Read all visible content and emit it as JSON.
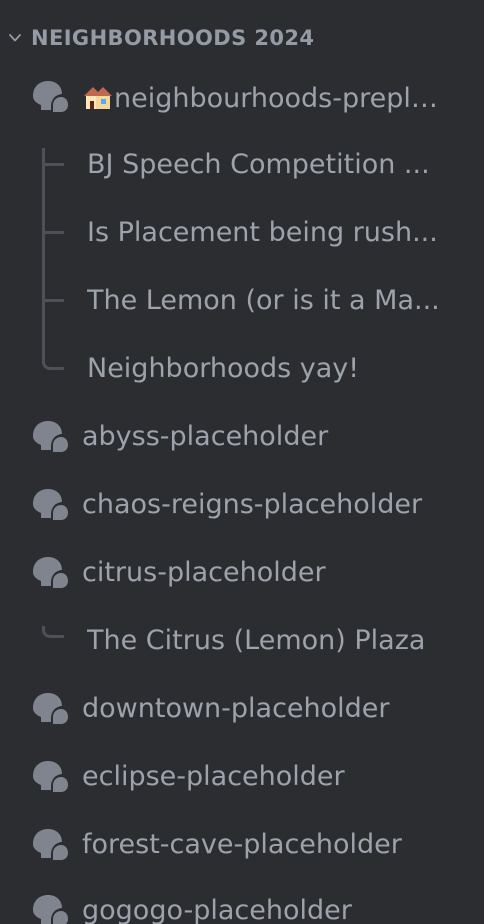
{
  "category": {
    "label": "NEIGHBORHOODS 2024"
  },
  "channels": [
    {
      "label": "neighbourhoods-preplacement",
      "emoji": "house-emoji"
    },
    {
      "label": "abyss-placeholder"
    },
    {
      "label": "chaos-reigns-placeholder"
    },
    {
      "label": "citrus-placeholder"
    },
    {
      "label": "downtown-placeholder"
    },
    {
      "label": "eclipse-placeholder"
    },
    {
      "label": "forest-cave-placeholder"
    },
    {
      "label": "gogogo-placeholder"
    }
  ],
  "threads": {
    "neighbourhoods": [
      {
        "label": "BJ Speech Competition ..."
      },
      {
        "label": "Is Placement being rush..."
      },
      {
        "label": "The Lemon (or is it a Ma..."
      },
      {
        "label": "Neighborhoods yay!"
      }
    ],
    "citrus": [
      {
        "label": "The Citrus (Lemon) Plaza"
      }
    ]
  },
  "colors": {
    "background": "#2b2d31",
    "text": "#9ea3ab",
    "category": "#949ba4",
    "icon": "#80848e",
    "tree_line": "#4e5058"
  },
  "icons": {
    "category_chevron": "chevron-down-icon",
    "forum_channel": "forum-icon"
  }
}
